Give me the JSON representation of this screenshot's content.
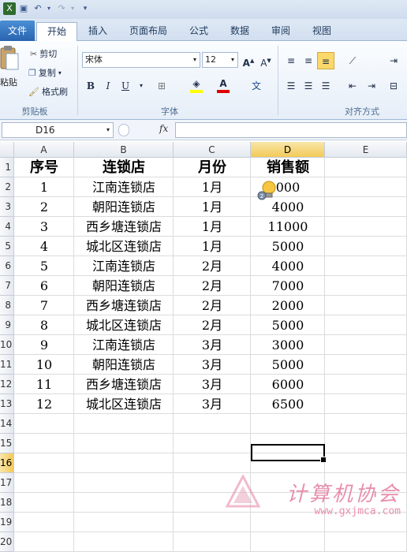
{
  "tabs": {
    "file": "文件",
    "home": "开始",
    "insert": "插入",
    "layout": "页面布局",
    "formulas": "公式",
    "data": "数据",
    "review": "审阅",
    "view": "视图"
  },
  "ribbon": {
    "clipboard": {
      "paste": "粘贴",
      "cut": "剪切",
      "copy": "复制",
      "format_painter": "格式刷",
      "label": "剪贴板"
    },
    "font": {
      "name": "宋体",
      "size": "12",
      "bold": "B",
      "italic": "I",
      "underline": "U",
      "label": "字体"
    },
    "alignment": {
      "label": "对齐方式"
    }
  },
  "formula_bar": {
    "name_box": "D16",
    "fx": "fx",
    "value": ""
  },
  "sheet": {
    "columns": [
      "A",
      "B",
      "C",
      "D",
      "E"
    ],
    "rows": [
      "1",
      "2",
      "3",
      "4",
      "5",
      "6",
      "7",
      "8",
      "9",
      "10",
      "11",
      "12",
      "13",
      "14",
      "15",
      "16",
      "17",
      "18",
      "19",
      "20"
    ],
    "selected_column": "D",
    "selected_row": "16",
    "header": [
      "序号",
      "连锁店",
      "月份",
      "销售额"
    ],
    "data": [
      [
        "1",
        "江南连锁店",
        "1月",
        "000"
      ],
      [
        "2",
        "朝阳连锁店",
        "1月",
        "4000"
      ],
      [
        "3",
        "西乡塘连锁店",
        "1月",
        "11000"
      ],
      [
        "4",
        "城北区连锁店",
        "1月",
        "5000"
      ],
      [
        "5",
        "江南连锁店",
        "2月",
        "4000"
      ],
      [
        "6",
        "朝阳连锁店",
        "2月",
        "7000"
      ],
      [
        "7",
        "西乡塘连锁店",
        "2月",
        "2000"
      ],
      [
        "8",
        "城北区连锁店",
        "2月",
        "5000"
      ],
      [
        "9",
        "江南连锁店",
        "3月",
        "3000"
      ],
      [
        "10",
        "朝阳连锁店",
        "3月",
        "5000"
      ],
      [
        "11",
        "西乡塘连锁店",
        "3月",
        "6000"
      ],
      [
        "12",
        "城北区连锁店",
        "3月",
        "6500"
      ]
    ]
  },
  "watermark": {
    "title": "计算机协会",
    "url": "www.gxjmca.com"
  },
  "colors": {
    "file_tab": "#2a64b0",
    "selected_header": "#f3ca5a",
    "watermark": "#e88fae"
  }
}
